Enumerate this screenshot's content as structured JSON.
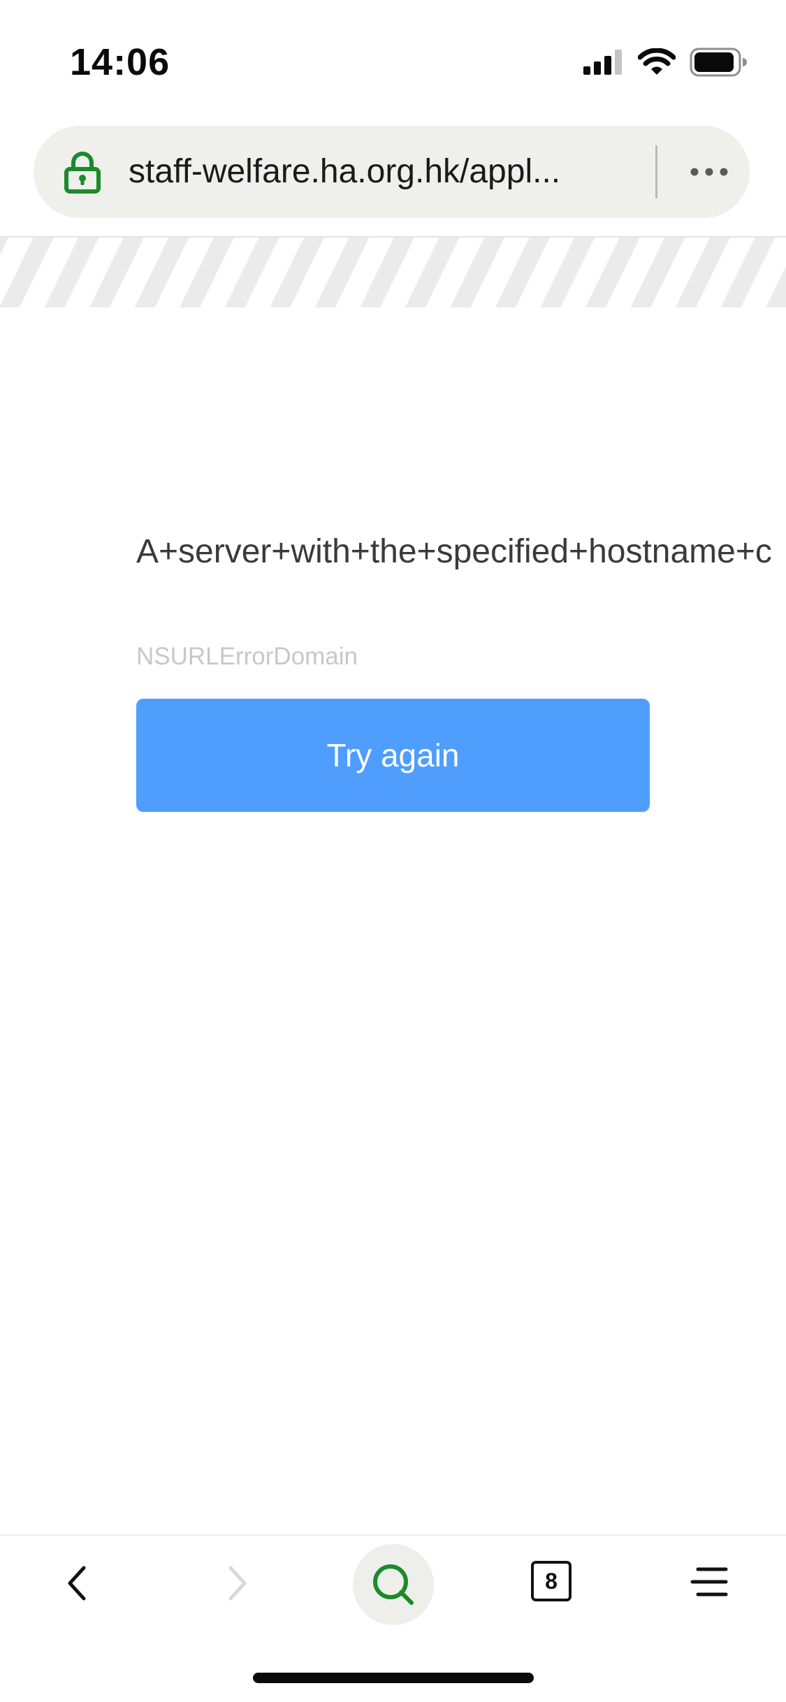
{
  "status_bar": {
    "time": "14:06",
    "icons": [
      "cellular-signal-icon",
      "wifi-icon",
      "battery-icon"
    ]
  },
  "address_bar": {
    "url": "staff-welfare.ha.org.hk/appl...",
    "secure_icon": "lock-icon",
    "more_icon": "more-dots-icon"
  },
  "error": {
    "message": "A+server+with+the+specified+hostname+c",
    "domain": "NSURLErrorDomain",
    "retry_label": "Try again"
  },
  "toolbar": {
    "tab_count": "8",
    "items": [
      "back-icon",
      "forward-icon",
      "search-icon",
      "tabs-icon",
      "menu-icon"
    ]
  },
  "colors": {
    "brand_green": "#1b8a2b",
    "button_blue": "#4f9efd",
    "address_bg": "#efefeb"
  }
}
